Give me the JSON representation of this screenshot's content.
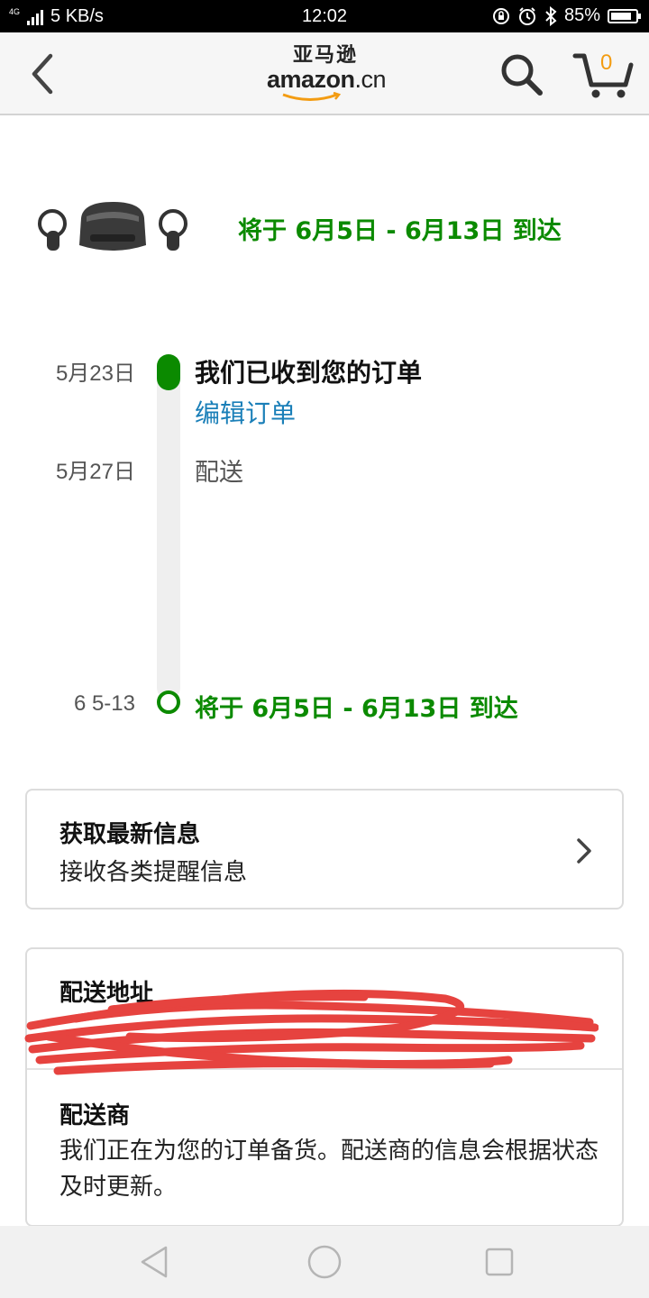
{
  "status_bar": {
    "network_type": "4G",
    "speed": "5 KB/s",
    "time": "12:02",
    "battery": "85%",
    "battery_level": 0.85,
    "icons": [
      "signal-icon",
      "lock-rotation-icon",
      "alarm-icon",
      "bluetooth-icon",
      "battery-icon"
    ]
  },
  "header": {
    "logo_cn": "亚马逊",
    "logo_en": "amazon",
    "logo_domain": ".cn",
    "cart_count": "0",
    "icons": [
      "back-arrow-icon",
      "search-icon",
      "cart-icon"
    ]
  },
  "delivery": {
    "estimate": "将于 6月5日 - 6月13日 到达"
  },
  "timeline": [
    {
      "date": "5月23日",
      "title": "我们已收到您的订单",
      "link": "编辑订单"
    },
    {
      "date": "5月27日",
      "title": "配送"
    },
    {
      "date": "6 5-13",
      "title": "将于 6月5日 - 6月13日 到达"
    }
  ],
  "updates_card": {
    "title": "获取最新信息",
    "subtitle": "接收各类提醒信息"
  },
  "address_card": {
    "title": "配送地址",
    "carrier_title": "配送商",
    "carrier_text": "我们正在为您的订单备货。配送商的信息会根据状态及时更新。"
  },
  "colors": {
    "brand_green": "#0b8a00",
    "link_blue": "#1a7fb8",
    "cart_orange": "#f39c12",
    "redaction_red": "#e53935"
  }
}
